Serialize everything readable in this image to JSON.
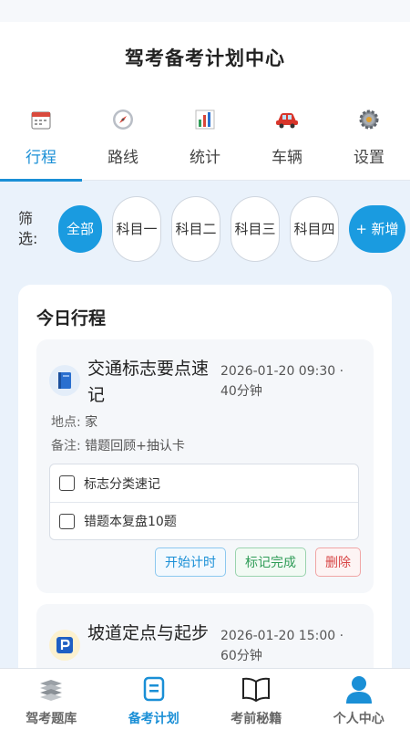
{
  "header": {
    "title": "驾考备考计划中心"
  },
  "tabs": [
    {
      "label": "行程",
      "icon": "calendar-icon",
      "active": true
    },
    {
      "label": "路线",
      "icon": "compass-icon",
      "active": false
    },
    {
      "label": "统计",
      "icon": "bar-chart-icon",
      "active": false
    },
    {
      "label": "车辆",
      "icon": "car-icon",
      "active": false
    },
    {
      "label": "设置",
      "icon": "gear-icon",
      "active": false
    }
  ],
  "filter": {
    "label": "筛选:",
    "chips": [
      {
        "label": "全部",
        "selected": true
      },
      {
        "label": "科目一",
        "selected": false
      },
      {
        "label": "科目二",
        "selected": false
      },
      {
        "label": "科目三",
        "selected": false
      },
      {
        "label": "科目四",
        "selected": false
      }
    ],
    "add_label": "+ 新增"
  },
  "today": {
    "title": "今日行程",
    "items": [
      {
        "icon": "book-icon",
        "name": "交通标志要点速记",
        "time": "2026-01-20 09:30 · 40分钟",
        "location_key": "地点:",
        "location": "家",
        "note_key": "备注:",
        "note": "错题回顾+抽认卡",
        "checklist": [
          {
            "label": "标志分类速记",
            "checked": false
          },
          {
            "label": "错题本复盘10题",
            "checked": false
          }
        ],
        "actions": {
          "start": "开始计时",
          "done": "标记完成",
          "delete": "删除"
        }
      },
      {
        "icon": "parking-icon",
        "name": "坡道定点与起步",
        "time": "2026-01-20 15:00 · 60分钟"
      }
    ]
  },
  "bottom_nav": [
    {
      "label": "驾考题库",
      "icon": "question-bank-icon",
      "active": false
    },
    {
      "label": "备考计划",
      "icon": "plan-list-icon",
      "active": true
    },
    {
      "label": "考前秘籍",
      "icon": "open-book-icon",
      "active": false
    },
    {
      "label": "个人中心",
      "icon": "user-icon",
      "active": false
    }
  ],
  "colors": {
    "accent": "#1a8fd6",
    "chip_active": "#1a9be0"
  }
}
